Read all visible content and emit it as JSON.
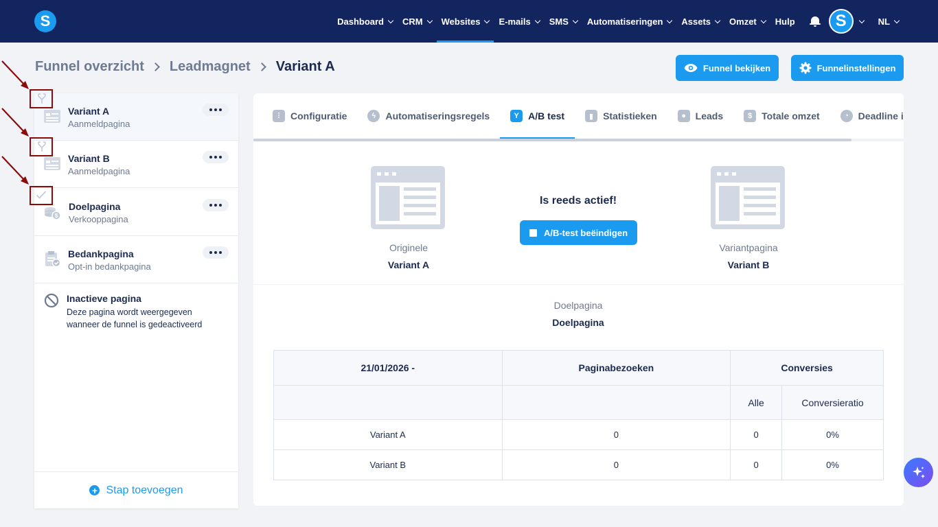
{
  "app": {
    "logo_letter": "S",
    "accent_color": "#1a9bf0",
    "nav_bg_color": "#13255e"
  },
  "nav": {
    "items": [
      {
        "label": "Dashboard",
        "dropdown": true
      },
      {
        "label": "CRM",
        "dropdown": true
      },
      {
        "label": "Websites",
        "dropdown": true,
        "active": true
      },
      {
        "label": "E-mails",
        "dropdown": true
      },
      {
        "label": "SMS",
        "dropdown": true
      },
      {
        "label": "Automatiseringen",
        "dropdown": true
      },
      {
        "label": "Assets",
        "dropdown": true
      },
      {
        "label": "Omzet",
        "dropdown": true
      },
      {
        "label": "Hulp",
        "dropdown": false
      }
    ],
    "avatar_letter": "S",
    "language": "NL"
  },
  "breadcrumb": {
    "items": [
      "Funnel overzicht",
      "Leadmagnet"
    ],
    "current": "Variant A"
  },
  "header_buttons": {
    "view_funnel": "Funnel bekijken",
    "funnel_settings": "Funnelinstellingen"
  },
  "sidebar": {
    "steps": [
      {
        "title": "Variant A",
        "subtitle": "Aanmeldpagina",
        "icon": "split-icon",
        "active": true
      },
      {
        "title": "Variant B",
        "subtitle": "Aanmeldpagina",
        "icon": "split-icon"
      },
      {
        "title": "Doelpagina",
        "subtitle": "Verkooppagina",
        "icon": "check-icon"
      },
      {
        "title": "Bedankpagina",
        "subtitle": "Opt-in bedankpagina",
        "icon": "clipboard-check-icon"
      }
    ],
    "inactive": {
      "title": "Inactieve pagina",
      "description": "Deze pagina wordt weergegeven wanneer de funnel is gedeactiveerd"
    },
    "add_step": "Stap toevoegen"
  },
  "tabs": [
    {
      "label": "Configuratie",
      "icon": "sliders-icon"
    },
    {
      "label": "Automatiseringsregels",
      "icon": "bolt-icon"
    },
    {
      "label": "A/B test",
      "icon": "split-icon",
      "active": true
    },
    {
      "label": "Statistieken",
      "icon": "bar-chart-icon"
    },
    {
      "label": "Leads",
      "icon": "users-icon"
    },
    {
      "label": "Totale omzet",
      "icon": "dollar-icon"
    },
    {
      "label": "Deadline ir",
      "icon": "clock-icon"
    }
  ],
  "ab_test": {
    "original_label": "Originele",
    "original_name": "Variant A",
    "variant_label": "Variantpagina",
    "variant_name": "Variant B",
    "status": "Is reeds actief!",
    "end_button": "A/B-test beëindigen",
    "goal_label": "Doelpagina",
    "goal_name": "Doelpagina"
  },
  "stats_table": {
    "date": "21/01/2026 -",
    "col_visits": "Paginabezoeken",
    "col_conversions": "Conversies",
    "sub_all": "Alle",
    "sub_rate": "Conversieratio",
    "rows": [
      {
        "name": "Variant A",
        "visits": "0",
        "all": "0",
        "rate": "0%"
      },
      {
        "name": "Variant B",
        "visits": "0",
        "all": "0",
        "rate": "0%"
      }
    ]
  }
}
